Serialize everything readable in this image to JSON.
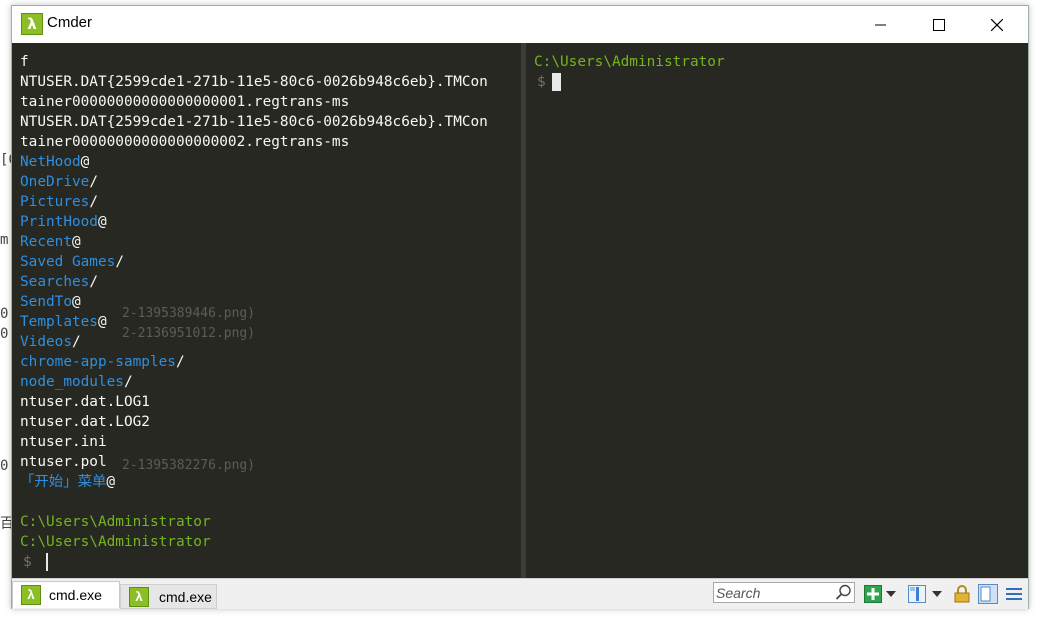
{
  "window": {
    "title": "Cmder"
  },
  "background_fragments": {
    "left": [
      "[C",
      "m",
      "0",
      "0",
      "0",
      "百"
    ],
    "faint": [
      "2-1395389446.png)",
      "2-2136951012.png)",
      "2-1395382276.png)"
    ]
  },
  "left_pane": {
    "lines": [
      {
        "text": "f",
        "color": "white"
      },
      {
        "text": "NTUSER.DAT{2599cde1-271b-11e5-80c6-0026b948c6eb}.TMCon",
        "color": "white"
      },
      {
        "text": "tainer00000000000000000001.regtrans-ms",
        "color": "white"
      },
      {
        "text": "NTUSER.DAT{2599cde1-271b-11e5-80c6-0026b948c6eb}.TMCon",
        "color": "white"
      },
      {
        "text": "tainer00000000000000000002.regtrans-ms",
        "color": "white"
      },
      {
        "name": "NetHood",
        "suffix": "@",
        "color": "blue"
      },
      {
        "name": "OneDrive",
        "suffix": "/",
        "color": "blue"
      },
      {
        "name": "Pictures",
        "suffix": "/",
        "color": "blue"
      },
      {
        "name": "PrintHood",
        "suffix": "@",
        "color": "blue"
      },
      {
        "name": "Recent",
        "suffix": "@",
        "color": "blue"
      },
      {
        "name": "Saved Games",
        "suffix": "/",
        "color": "blue"
      },
      {
        "name": "Searches",
        "suffix": "/",
        "color": "blue"
      },
      {
        "name": "SendTo",
        "suffix": "@",
        "color": "blue"
      },
      {
        "name": "Templates",
        "suffix": "@",
        "color": "blue"
      },
      {
        "name": "Videos",
        "suffix": "/",
        "color": "blue"
      },
      {
        "name": "chrome-app-samples",
        "suffix": "/",
        "color": "blue"
      },
      {
        "name": "node_modules",
        "suffix": "/",
        "color": "blue"
      },
      {
        "text": "ntuser.dat.LOG1",
        "color": "white"
      },
      {
        "text": "ntuser.dat.LOG2",
        "color": "white"
      },
      {
        "text": "ntuser.ini",
        "color": "white"
      },
      {
        "text": "ntuser.pol",
        "color": "white"
      },
      {
        "name": "「开始」菜单",
        "suffix": "@",
        "color": "blue"
      },
      {
        "text": "",
        "color": "white"
      },
      {
        "text": "C:\\Users\\Administrator",
        "color": "green"
      },
      {
        "text": "C:\\Users\\Administrator",
        "color": "green"
      }
    ],
    "prompt": "$"
  },
  "right_pane": {
    "path": "C:\\Users\\Administrator",
    "prompt": "$"
  },
  "statusbar": {
    "tabs": [
      {
        "label": "cmd.exe",
        "active": true
      },
      {
        "label": "cmd.exe",
        "active": false
      }
    ],
    "search_placeholder": "Search"
  },
  "icons": {
    "app": "lambda-icon",
    "minimize": "minimize-icon",
    "maximize": "maximize-icon",
    "close": "close-icon",
    "search": "search-icon",
    "new_console": "plus-icon",
    "split": "split-view-icon",
    "lock": "lock-icon",
    "layout": "layout-icon",
    "menu": "menu-icon"
  },
  "colors": {
    "terminal_bg": "#272822",
    "dir_blue": "#2e8fe0",
    "path_green": "#73b51e",
    "text": "#f8f8f2",
    "accent_green": "#8cbf26"
  }
}
